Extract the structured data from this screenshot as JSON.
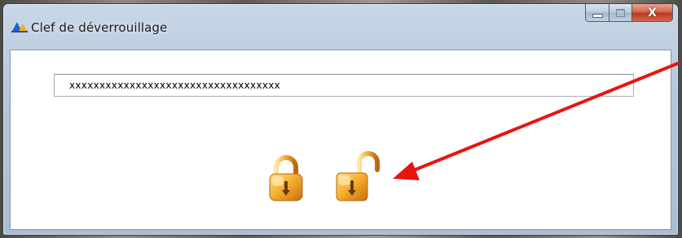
{
  "window": {
    "title": "Clef de déverrouillage",
    "controls": {
      "minimize": "minimize",
      "maximize": "maximize",
      "close": "X"
    }
  },
  "key_field": {
    "value": "xxxxxxxxxxxxxxxxxxxxxxxxxxxxxxxxxxx"
  },
  "icons": {
    "app": "app-icon",
    "lock_closed": "lock-closed-icon",
    "lock_open": "lock-open-icon"
  },
  "annotation": {
    "type": "arrow",
    "color": "#e8150e",
    "points_to": "lock-open-icon"
  },
  "colors": {
    "lock_gold": "#f3a628",
    "close_red": "#c8452d"
  }
}
